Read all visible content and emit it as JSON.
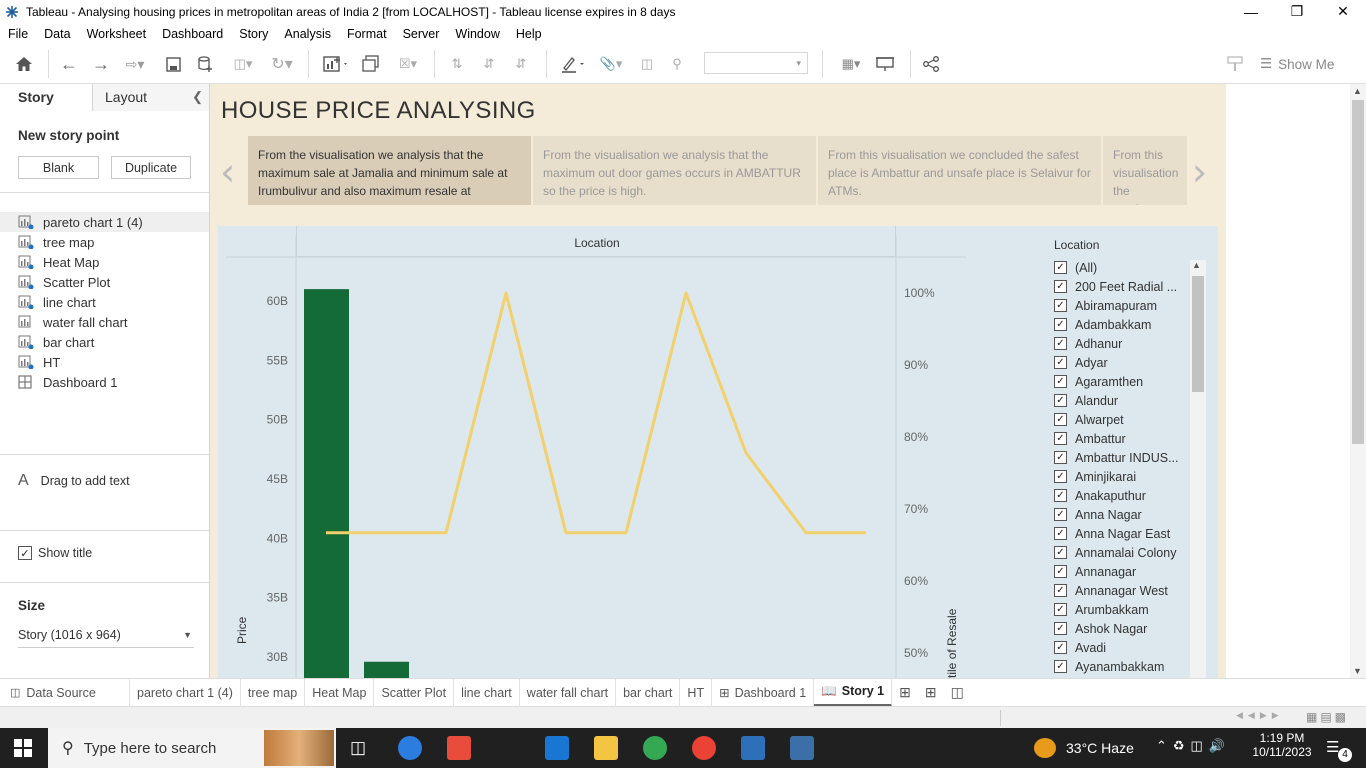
{
  "window": {
    "title": "Tableau - Analysing housing prices in metropolitan areas of India 2 [from LOCALHOST] - Tableau license expires in 8 days"
  },
  "menu": [
    "File",
    "Data",
    "Worksheet",
    "Dashboard",
    "Story",
    "Analysis",
    "Format",
    "Server",
    "Window",
    "Help"
  ],
  "toolbar": {
    "show_me": "Show Me"
  },
  "left": {
    "tab_story": "Story",
    "tab_layout": "Layout",
    "new_story_point": "New story point",
    "blank": "Blank",
    "duplicate": "Duplicate",
    "sheets": [
      "pareto chart 1 (4)",
      "tree map",
      "Heat Map",
      "Scatter Plot",
      "line chart",
      "water fall chart",
      "bar chart",
      "HT",
      "Dashboard 1"
    ],
    "drag_text": "Drag to add text",
    "show_title": "Show title",
    "size_label": "Size",
    "size_value": "Story (1016 x 964)"
  },
  "story": {
    "title": "HOUSE PRICE ANALYSING",
    "points": [
      "From the visualisation   we analysis that the maximum sale at Jamalia and  minimum sale at  Irumbulivur and also maximum resale at",
      "From the visualisation we analysis that the maximum out door games occurs in AMBATTUR so the price is high.",
      "From this visualisation we concluded the safest place is Ambattur and unsafe place is Selaivur for ATMs.",
      "From this visualisation the maximum facility in Sholinganallur"
    ]
  },
  "chart_data": {
    "type": "bar",
    "header": "Location",
    "ylabel": "Price",
    "y2label": "Percentile of Resale",
    "yticks": [
      "60B",
      "55B",
      "50B",
      "45B",
      "40B",
      "35B",
      "30B"
    ],
    "y2ticks": [
      "100%",
      "90%",
      "80%",
      "70%",
      "60%",
      "50%"
    ],
    "ylim": [
      29,
      64
    ],
    "y2lim": [
      48,
      103
    ],
    "bars": [
      61,
      29.6
    ],
    "line_x_index": [
      0,
      1,
      2,
      3,
      4,
      5,
      6,
      7,
      8,
      9
    ],
    "line_values": [
      66.7,
      66.7,
      66.7,
      100,
      66.7,
      66.7,
      100,
      77.8,
      66.7,
      66.7
    ],
    "bar_color": "#156b37",
    "line_color": "#f2d06b"
  },
  "legend": {
    "title": "Location",
    "items": [
      "(All)",
      "200 Feet Radial ...",
      "Abiramapuram",
      "Adambakkam",
      "Adhanur",
      "Adyar",
      "Agaramthen",
      "Alandur",
      "Alwarpet",
      "Ambattur",
      "Ambattur INDUS...",
      "Aminjikarai",
      "Anakaputhur",
      "Anna Nagar",
      "Anna Nagar East",
      "Annamalai Colony",
      "Annanagar",
      "Annanagar West",
      "Arumbakkam",
      "Ashok Nagar",
      "Avadi",
      "Ayanambakkam"
    ]
  },
  "tabs": [
    "Data Source",
    "pareto chart 1 (4)",
    "tree map",
    "Heat Map",
    "Scatter Plot",
    "line chart",
    "water fall chart",
    "bar chart",
    "HT",
    "Dashboard 1",
    "Story 1"
  ],
  "taskbar": {
    "search": "Type here to search",
    "weather": "33°C  Haze",
    "time": "1:19 PM",
    "date": "10/11/2023",
    "notif": "4"
  }
}
